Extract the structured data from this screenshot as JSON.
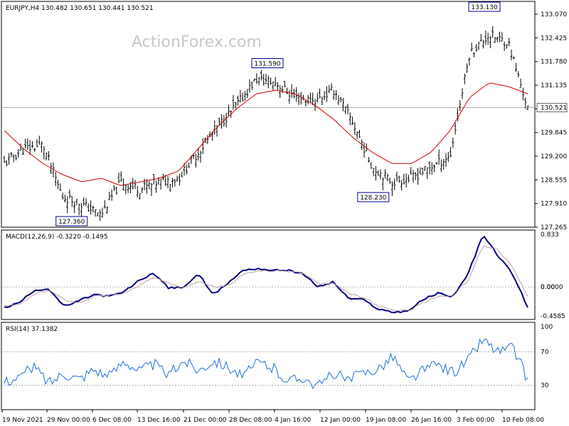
{
  "colors": {
    "price": "#000000",
    "ma": "#d40000",
    "macd": "#000080",
    "signal": "#c0a0a0",
    "rsi": "#1e6fd9",
    "grid": "#808080",
    "box": "#0000a0"
  },
  "chart_data": [
    {
      "panel": "price",
      "type": "bar",
      "title": "EURJPY,H4  130.482 130.651 130.441 130.521",
      "watermark": "ActionForex.com",
      "ylim": [
        127.265,
        133.07
      ],
      "yticks": [
        "133.070",
        "132.425",
        "131.780",
        "131.135",
        "130.490",
        "129.845",
        "129.200",
        "128.555",
        "127.910",
        "127.265"
      ],
      "current_price": "130.521",
      "x": [
        "19 Nov 2021",
        "29 Nov 00:00",
        "6 Dec 08:00",
        "13 Dec 16:00",
        "21 Dec 00:00",
        "28 Dec 08:00",
        "4 Jan 16:00",
        "12 Jan 00:00",
        "19 Jan 08:00",
        "26 Jan 16:00",
        "3 Feb 00:00",
        "10 Feb 08:00"
      ],
      "close": [
        129.0,
        129.4,
        129.5,
        128.1,
        127.9,
        127.6,
        128.5,
        128.3,
        128.5,
        128.6,
        129.3,
        130.0,
        130.6,
        131.3,
        131.2,
        130.8,
        130.7,
        131.0,
        130.1,
        128.9,
        128.5,
        128.6,
        128.9,
        129.2,
        132.0,
        132.5,
        132.3,
        130.5
      ],
      "ma": [
        129.9,
        129.4,
        129.0,
        128.7,
        128.5,
        128.6,
        128.4,
        128.5,
        128.6,
        128.8,
        129.4,
        130.0,
        130.5,
        130.9,
        131.0,
        130.9,
        130.6,
        130.2,
        129.7,
        129.3,
        129.0,
        129.0,
        129.3,
        129.9,
        130.8,
        131.2,
        131.1,
        130.9
      ],
      "annotations": [
        {
          "label": "127.360",
          "value": 127.36
        },
        {
          "label": "131.590",
          "value": 131.59
        },
        {
          "label": "128.230",
          "value": 128.23
        },
        {
          "label": "133.130",
          "value": 133.13
        }
      ]
    },
    {
      "panel": "macd",
      "type": "line",
      "title": "MACD(12,26,9) -0.3220 -0.1495",
      "ylim": [
        -0.4585,
        0.833
      ],
      "yticks": [
        "0.833",
        "0.0000",
        "-0.4585"
      ],
      "zero_label": "0.00",
      "series": [
        {
          "key": "macd",
          "values": [
            -0.33,
            -0.25,
            -0.05,
            -0.03,
            -0.31,
            -0.22,
            -0.12,
            -0.15,
            -0.08,
            0.1,
            0.22,
            -0.02,
            0.0,
            0.2,
            -0.12,
            0.07,
            0.27,
            0.29,
            0.26,
            0.27,
            0.2,
            0.0,
            0.08,
            -0.18,
            -0.2,
            -0.35,
            -0.4,
            -0.38,
            -0.2,
            -0.1,
            -0.15,
            0.2,
            0.82,
            0.5,
            0.2,
            -0.32
          ]
        },
        {
          "key": "signal",
          "values": [
            -0.3,
            -0.28,
            -0.12,
            -0.05,
            -0.2,
            -0.25,
            -0.15,
            -0.13,
            -0.1,
            0.02,
            0.15,
            0.05,
            0.0,
            0.1,
            0.0,
            0.02,
            0.2,
            0.26,
            0.25,
            0.25,
            0.22,
            0.05,
            0.05,
            -0.1,
            -0.17,
            -0.3,
            -0.37,
            -0.37,
            -0.25,
            -0.15,
            -0.14,
            0.1,
            0.65,
            0.6,
            0.3,
            -0.15
          ]
        }
      ]
    },
    {
      "panel": "rsi",
      "type": "line",
      "title": "RSI(14) 37.1382",
      "ylim": [
        0,
        100
      ],
      "yticks": [
        "100",
        "70",
        "30"
      ],
      "levels": [
        70,
        30
      ],
      "series": [
        {
          "key": "rsi",
          "values": [
            35,
            40,
            52,
            33,
            45,
            38,
            50,
            40,
            60,
            48,
            55,
            42,
            60,
            48,
            60,
            52,
            40,
            58,
            50,
            35,
            40,
            28,
            45,
            35,
            45,
            50,
            65,
            35,
            48,
            55,
            45,
            60,
            85,
            70,
            75,
            37
          ]
        }
      ]
    }
  ]
}
